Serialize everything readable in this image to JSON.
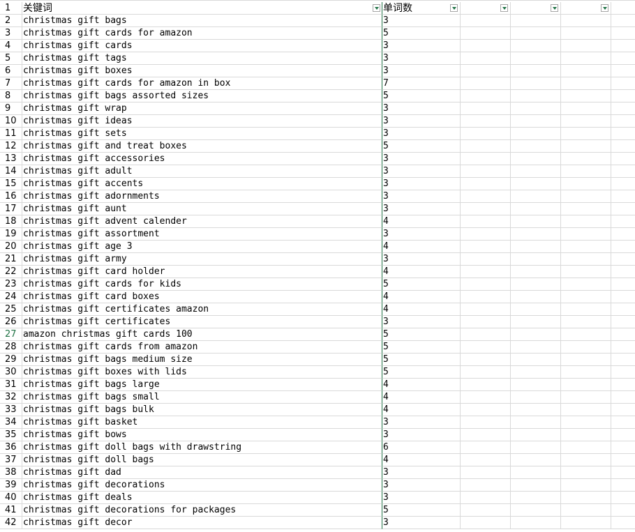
{
  "headers": {
    "row_num": "1",
    "colA": "关键词",
    "colB": "单词数"
  },
  "active_row": 27,
  "rows": [
    {
      "n": "2",
      "kw": "christmas gift bags",
      "c": "3"
    },
    {
      "n": "3",
      "kw": "christmas gift cards for amazon",
      "c": "5"
    },
    {
      "n": "4",
      "kw": "christmas gift cards",
      "c": "3"
    },
    {
      "n": "5",
      "kw": "christmas gift tags",
      "c": "3"
    },
    {
      "n": "6",
      "kw": "christmas gift boxes",
      "c": "3"
    },
    {
      "n": "7",
      "kw": "christmas gift cards for amazon in box",
      "c": "7"
    },
    {
      "n": "8",
      "kw": "christmas gift bags assorted sizes",
      "c": "5"
    },
    {
      "n": "9",
      "kw": "christmas gift wrap",
      "c": "3"
    },
    {
      "n": "10",
      "kw": "christmas gift ideas",
      "c": "3"
    },
    {
      "n": "11",
      "kw": "christmas gift sets",
      "c": "3"
    },
    {
      "n": "12",
      "kw": "christmas gift and treat boxes",
      "c": "5"
    },
    {
      "n": "13",
      "kw": "christmas gift accessories",
      "c": "3"
    },
    {
      "n": "14",
      "kw": "christmas gift adult",
      "c": "3"
    },
    {
      "n": "15",
      "kw": "christmas gift accents",
      "c": "3"
    },
    {
      "n": "16",
      "kw": "christmas gift adornments",
      "c": "3"
    },
    {
      "n": "17",
      "kw": "christmas gift aunt",
      "c": "3"
    },
    {
      "n": "18",
      "kw": "christmas gift advent calender",
      "c": "4"
    },
    {
      "n": "19",
      "kw": "christmas gift assortment",
      "c": "3"
    },
    {
      "n": "20",
      "kw": "christmas gift age 3",
      "c": "4"
    },
    {
      "n": "21",
      "kw": "christmas gift army",
      "c": "3"
    },
    {
      "n": "22",
      "kw": "christmas gift card holder",
      "c": "4"
    },
    {
      "n": "23",
      "kw": "christmas gift cards for kids",
      "c": "5"
    },
    {
      "n": "24",
      "kw": "christmas gift card boxes",
      "c": "4"
    },
    {
      "n": "25",
      "kw": "christmas gift certificates amazon",
      "c": "4"
    },
    {
      "n": "26",
      "kw": "christmas gift certificates",
      "c": "3"
    },
    {
      "n": "27",
      "kw": "amazon christmas gift cards 100",
      "c": "5"
    },
    {
      "n": "28",
      "kw": "christmas gift cards from amazon",
      "c": "5"
    },
    {
      "n": "29",
      "kw": "christmas gift bags medium size",
      "c": "5"
    },
    {
      "n": "30",
      "kw": "christmas gift boxes with lids",
      "c": "5"
    },
    {
      "n": "31",
      "kw": "christmas gift bags large",
      "c": "4"
    },
    {
      "n": "32",
      "kw": "christmas gift bags small",
      "c": "4"
    },
    {
      "n": "33",
      "kw": "christmas gift bags bulk",
      "c": "4"
    },
    {
      "n": "34",
      "kw": "christmas gift basket",
      "c": "3"
    },
    {
      "n": "35",
      "kw": "christmas gift bows",
      "c": "3"
    },
    {
      "n": "36",
      "kw": "christmas gift doll bags with drawstring",
      "c": "6"
    },
    {
      "n": "37",
      "kw": "christmas gift doll bags",
      "c": "4"
    },
    {
      "n": "38",
      "kw": "christmas gift dad",
      "c": "3"
    },
    {
      "n": "39",
      "kw": "christmas gift decorations",
      "c": "3"
    },
    {
      "n": "40",
      "kw": "christmas gift deals",
      "c": "3"
    },
    {
      "n": "41",
      "kw": "christmas gift decorations for packages",
      "c": "5"
    },
    {
      "n": "42",
      "kw": "christmas gift decor",
      "c": "3"
    }
  ],
  "colors": {
    "grid": "#d9d9d9",
    "accent": "#217346"
  },
  "icons": {
    "filter": "filter-dropdown-icon"
  }
}
